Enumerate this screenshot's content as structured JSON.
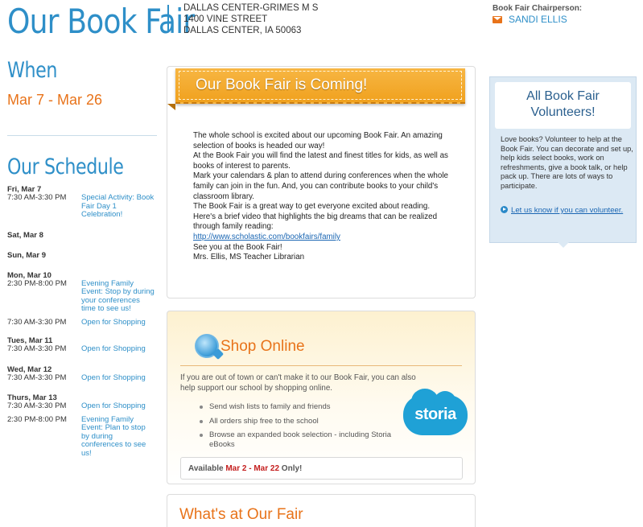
{
  "header": {
    "title": "Our Book Fair",
    "school": {
      "name": "DALLAS CENTER-GRIMES M S",
      "street": "1400 VINE STREET",
      "city": "DALLAS CENTER, IA 50063"
    },
    "chair_label": "Book Fair Chairperson:",
    "chair_name": "SANDI ELLIS",
    "chair_icon": "mail-icon"
  },
  "when": {
    "heading": "When",
    "dates": "Mar 7 - Mar 26"
  },
  "schedule": {
    "heading": "Our Schedule",
    "days": [
      {
        "date": "Fri, Mar 7",
        "events": [
          {
            "time": "7:30 AM-3:30 PM",
            "desc": "Special Activity: Book Fair Day 1 Celebration!"
          }
        ]
      },
      {
        "date": "Sat, Mar 8",
        "events": []
      },
      {
        "date": "Sun, Mar 9",
        "events": []
      },
      {
        "date": "Mon, Mar 10",
        "events": [
          {
            "time": "2:30 PM-8:00 PM",
            "desc": "Evening Family Event: Stop by during your conferences time to see us!"
          },
          {
            "time": "7:30 AM-3:30 PM",
            "desc": "Open for Shopping"
          }
        ]
      },
      {
        "date": "Tues, Mar 11",
        "events": [
          {
            "time": "7:30 AM-3:30 PM",
            "desc": "Open for Shopping"
          }
        ]
      },
      {
        "date": "Wed, Mar 12",
        "events": [
          {
            "time": "7:30 AM-3:30 PM",
            "desc": "Open for Shopping"
          }
        ]
      },
      {
        "date": "Thurs, Mar 13",
        "events": [
          {
            "time": "7:30 AM-3:30 PM",
            "desc": "Open for Shopping"
          },
          {
            "time": "2:30 PM-8:00 PM",
            "desc": "Evening Family Event: Plan to stop by during conferences to see us!"
          }
        ]
      }
    ]
  },
  "coming": {
    "title": "Our Book Fair is Coming!",
    "paragraphs": [
      "The whole school is excited about our upcoming Book Fair. An amazing selection of books is headed our way!",
      "At the Book Fair you will find the latest and finest titles for kids, as well as books of interest to parents.",
      "Mark your calendars & plan to attend during conferences when the whole family can join in the fun. And, you can contribute books to your child's classroom library.",
      "The Book Fair is a great way to get everyone excited about reading. Here's a brief video that highlights the big dreams that can be realized through family reading:"
    ],
    "link": "http://www.scholastic.com/bookfairs/family",
    "closing": "See you at the Book Fair!",
    "signature": "Mrs. Ellis, MS Teacher Librarian"
  },
  "shop": {
    "icon": "shop-online-icon",
    "title": "Shop Online",
    "intro": "If you are out of town or can't make it to our Book Fair, you can also help support our school by shopping online.",
    "bullets": [
      "Send wish lists to family and friends",
      "All orders ship free to the school",
      "Browse an expanded book selection - including Storia eBooks"
    ],
    "storia_label": "storia",
    "available_prefix": "Available ",
    "available_dates": "Mar 2 - Mar 22",
    "available_suffix": " Only!"
  },
  "fair": {
    "title": "What's at Our Fair"
  },
  "volunteer": {
    "title": "All Book Fair Volunteers!",
    "text": "Love books? Volunteer to help at the Book Fair. You can decorate and set up, help kids select books, work on refreshments, give a book talk, or help pack up. There are lots of ways to participate.",
    "link": "Let us know if you can volunteer."
  },
  "colors": {
    "brand_blue": "#2e8fc8",
    "accent_orange": "#e8731a",
    "available_red": "#c41e1e"
  }
}
